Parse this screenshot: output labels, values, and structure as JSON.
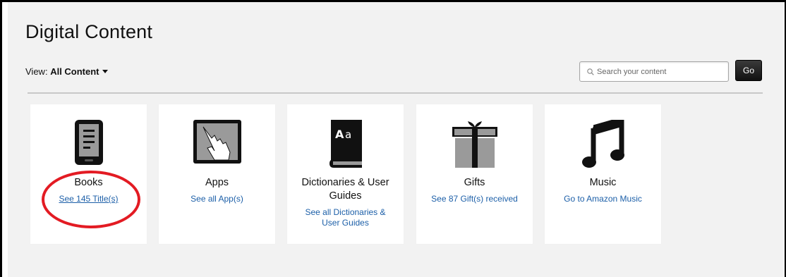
{
  "page": {
    "title": "Digital Content"
  },
  "view": {
    "label": "View:",
    "selected": "All Content"
  },
  "search": {
    "placeholder": "Search your content",
    "go_label": "Go"
  },
  "cards": [
    {
      "title": "Books",
      "link": "See 145 Title(s)",
      "icon": "ereader-icon"
    },
    {
      "title": "Apps",
      "link": "See all App(s)",
      "icon": "touch-hand-icon"
    },
    {
      "title": "Dictionaries & User Guides",
      "link": "See all Dictionaries & User Guides",
      "icon": "dictionary-book-icon"
    },
    {
      "title": "Gifts",
      "link": "See 87 Gift(s) received",
      "icon": "gift-box-icon"
    },
    {
      "title": "Music",
      "link": "Go to Amazon Music",
      "icon": "music-note-icon"
    }
  ],
  "colors": {
    "link": "#1c5fa8",
    "highlight": "#e31b23",
    "go_button": "#111111",
    "background": "#f2f2f2"
  }
}
